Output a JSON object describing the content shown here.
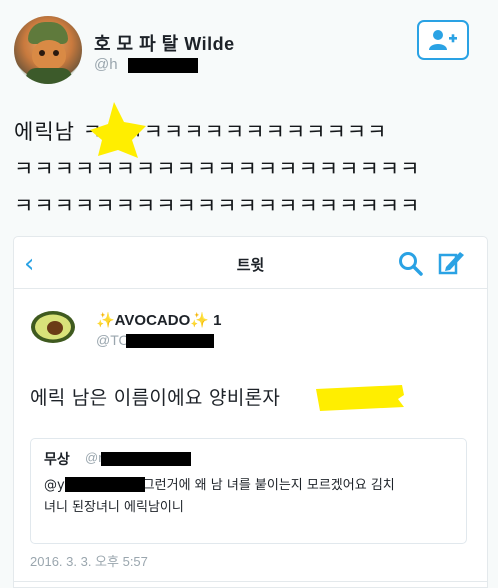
{
  "header": {
    "display_name": "호 모 파 탈 Wilde",
    "handle_prefix": "@h"
  },
  "tweet": {
    "line1": "에릭남  ㅋㅋㅋㅋㅋㅋㅋㅋㅋㅋㅋㅋㅋㅋㅋ",
    "line2": "ㅋㅋㅋㅋㅋㅋㅋㅋㅋㅋㅋㅋㅋㅋㅋㅋㅋㅋㅋㅋ",
    "line3": "ㅋㅋㅋㅋㅋㅋㅋㅋㅋㅋㅋㅋㅋㅋㅋㅋㅋㅋㅋㅋ"
  },
  "embedded": {
    "nav_title": "트윗",
    "author_name": "✨AVOCADO✨ 1",
    "author_handle_prefix": "@TO",
    "body": "에릭 남은 이름이에요 양비론자",
    "quote": {
      "name": "무상",
      "handle_prefix": "@r",
      "text_prefix": "@y",
      "text": "그런거에 왜 남 녀를 붙이는지 모르겠어요 김치",
      "text_line2": "녀니 된장녀니 에릭남이니"
    },
    "timestamp": "2016. 3. 3. 오후 5:57"
  },
  "colors": {
    "accent": "#2aa2e4",
    "highlight": "#ffee00",
    "redaction": "#000000"
  },
  "icons": [
    "follow-user-icon",
    "back-chevron-icon",
    "search-icon",
    "compose-icon",
    "avocado-avatar-icon"
  ]
}
